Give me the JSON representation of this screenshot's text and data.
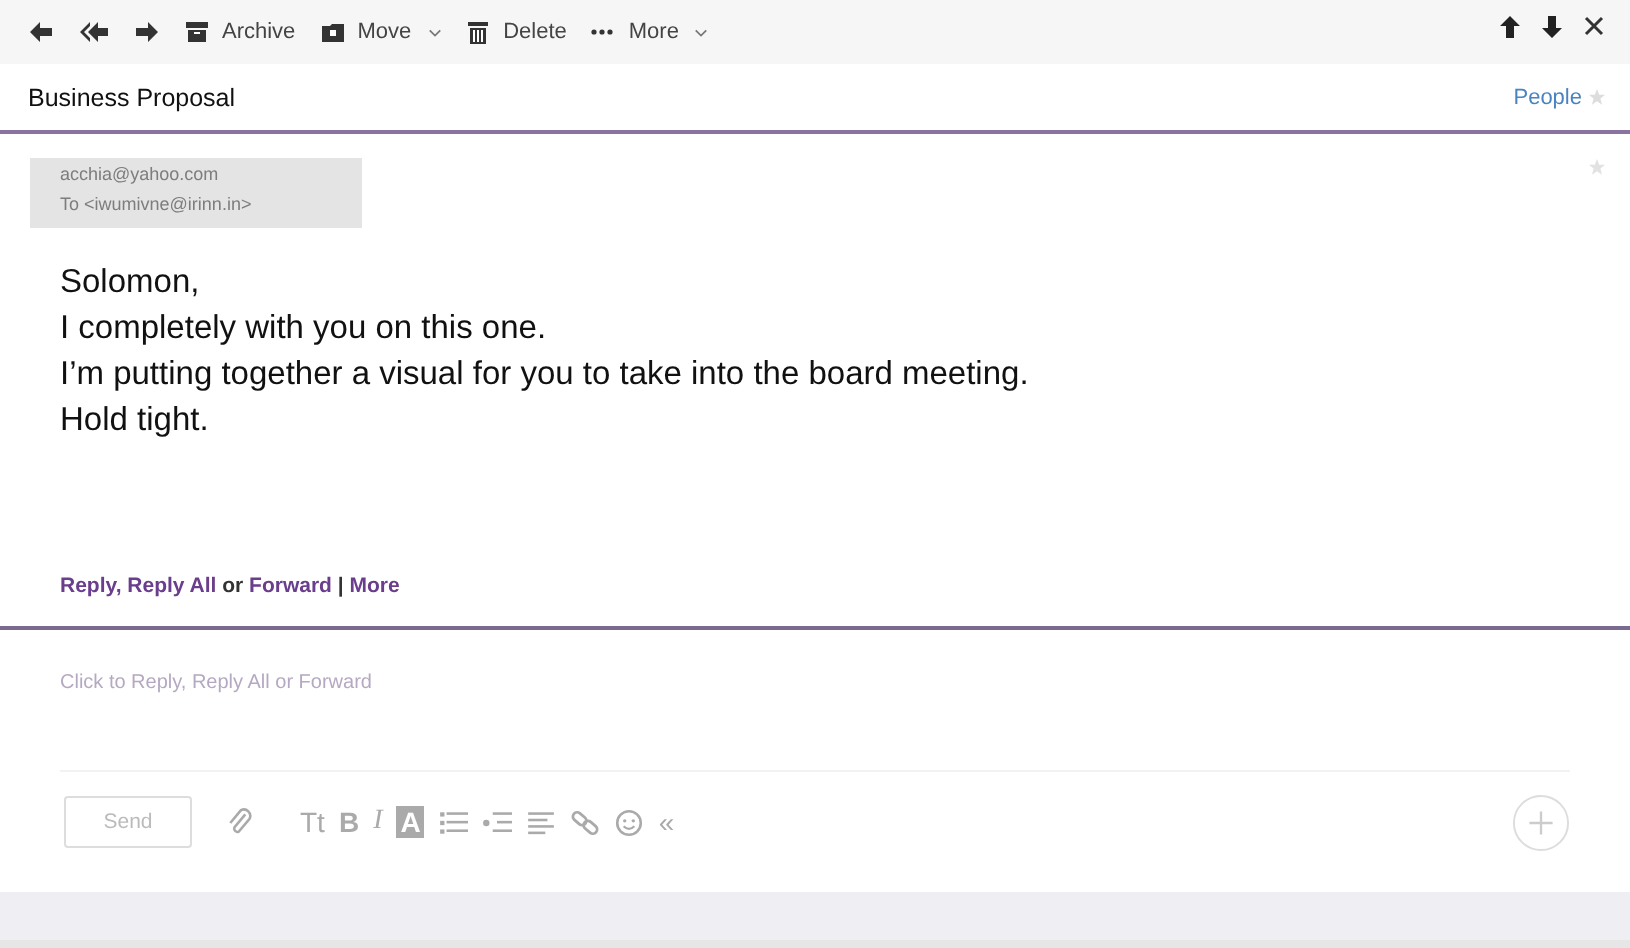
{
  "toolbar": {
    "actions": [
      {
        "kind": "reply"
      },
      {
        "kind": "reply-all"
      },
      {
        "kind": "forward"
      },
      {
        "kind": "archive",
        "label": "Archive"
      },
      {
        "kind": "move",
        "label": "Move",
        "dropdown": true
      },
      {
        "kind": "delete",
        "label": "Delete"
      },
      {
        "kind": "more",
        "label": "More",
        "dropdown": true
      }
    ],
    "nav": [
      {
        "kind": "up"
      },
      {
        "kind": "down"
      },
      {
        "kind": "close"
      }
    ]
  },
  "subject": "Business Proposal",
  "people_link": "People",
  "message": {
    "sender": "acchia@yahoo.com",
    "to_label": "To",
    "recipient": "<iwumivne@irinn.in>",
    "starred": false,
    "body": [
      "Solomon,",
      "I completely with you on this one.",
      "I’m putting together a visual for you to take into the board meeting.",
      "Hold tight."
    ],
    "reply_actions": [
      {
        "kind": "link",
        "text": "Reply,"
      },
      {
        "kind": "link",
        "text": "Reply All"
      },
      {
        "kind": "text",
        "text": "or"
      },
      {
        "kind": "link",
        "text": "Forward"
      },
      {
        "kind": "text",
        "text": "|"
      },
      {
        "kind": "link",
        "text": "More"
      }
    ]
  },
  "composer": {
    "placeholder": "Click to Reply, Reply All or Forward",
    "send": "Send",
    "tools": [
      {
        "kind": "attach"
      },
      {
        "kind": "size",
        "label": "Tt"
      },
      {
        "kind": "bold",
        "label": "B"
      },
      {
        "kind": "italic",
        "label": "I"
      },
      {
        "kind": "highlight",
        "label": "A"
      },
      {
        "kind": "list"
      },
      {
        "kind": "bullets"
      },
      {
        "kind": "align"
      },
      {
        "kind": "link"
      },
      {
        "kind": "emoji"
      },
      {
        "kind": "collapse",
        "label": "«"
      }
    ]
  }
}
